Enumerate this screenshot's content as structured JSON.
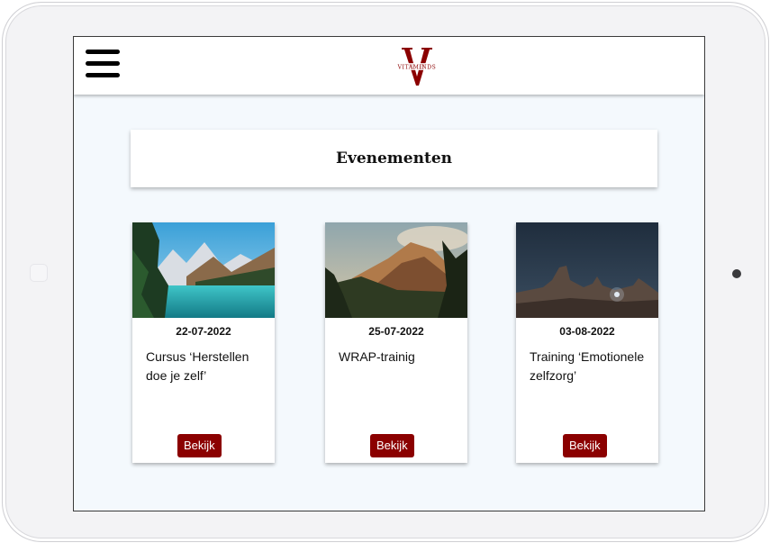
{
  "header": {
    "menu_icon": "hamburger-icon",
    "logo_letter": "V",
    "logo_text": "VITAMINDS",
    "brand_color": "#8b0000"
  },
  "main": {
    "title": "Evenementen",
    "events": [
      {
        "date": "22-07-2022",
        "title": "Cursus ‘Herstellen doe je zelf’",
        "button": "Bekijk",
        "image": "mountain-lake-photo"
      },
      {
        "date": "25-07-2022",
        "title": "WRAP-trainig",
        "button": "Bekijk",
        "image": "mountain-valley-photo"
      },
      {
        "date": "03-08-2022",
        "title": "Training ‘Emotionele zelfzorg’",
        "button": "Bekijk",
        "image": "desert-rock-night-photo"
      }
    ]
  }
}
